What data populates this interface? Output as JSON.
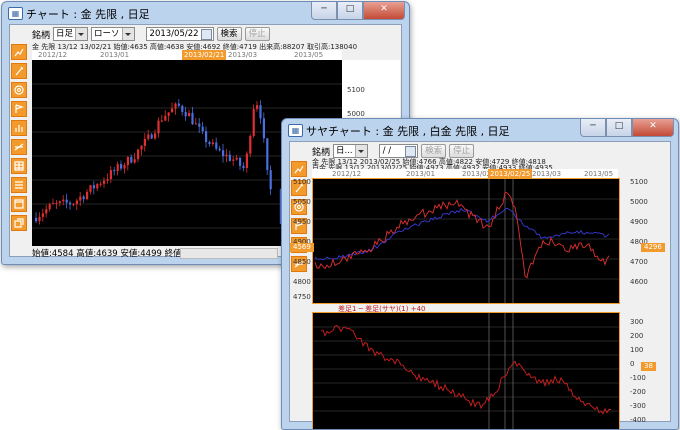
{
  "window1": {
    "title": "チャート : 金 先限 , 日足",
    "controls": {
      "minimize": "─",
      "maximize": "□",
      "close": "✕"
    },
    "toolbar": {
      "symbol_label": "銘柄",
      "period_value": "日足",
      "type_value": "ローソ",
      "date_value": "2013/05/22",
      "search_label": "検索",
      "stop_label": "停止"
    },
    "info_line": "金 先限  13/12  13/02/21  始値:4635 高値:4638 安値:4692 終値:4719 出来高:88207 取引高:138040",
    "date_labels": [
      "2012/12",
      "2013/01",
      "2013/02/21",
      "2013/03",
      "2013/05"
    ],
    "y_labels": [
      "5100",
      "5000",
      "4900",
      "4800",
      "4700",
      "4600",
      "4500"
    ],
    "status": {
      "open": "始値:4584",
      "high": "高値:4639",
      "low": "安値:4499",
      "close": "終値:4500"
    }
  },
  "window2": {
    "title": "サヤチャート : 金 先限 , 白金 先限 , 日足",
    "controls": {
      "minimize": "─",
      "maximize": "□",
      "close": "✕"
    },
    "toolbar": {
      "symbol_label": "銘柄",
      "period_value": "日...",
      "date_value": "/  /",
      "search_label": "検索",
      "stop_label": "停止"
    },
    "info_lines": [
      "金 先限  13/12  2013/02/25  始値:4766 高値:4822 安値:4729 終値:4818",
      "白金 先限  13/12  2013/02/25  始値:4973 高値:4932 安値:4933 終値:4935"
    ],
    "date_labels": [
      "2012/12",
      "2013/01",
      "2013/02",
      "2013/02/25",
      "2013/03",
      "2013/05"
    ],
    "left_y_labels": [
      "5100",
      "5050",
      "4950",
      "4900",
      "4850",
      "4800",
      "4750"
    ],
    "right_y_labels": [
      "5100",
      "5000",
      "4900",
      "4800",
      "4700",
      "4600"
    ],
    "left_tag": "4569",
    "right_tag": "4296",
    "spread_label": "差足1 ─ 差足(サヤ)(1) +40",
    "lower_y_labels": [
      "300",
      "200",
      "100",
      "0",
      "-100",
      "-200",
      "-300",
      "-400"
    ],
    "lower_tag": "38",
    "series": {
      "gold_color": "#e03030",
      "platinum_color": "#3a3ad8",
      "spread_color": "#d02020"
    }
  },
  "sidebar_icons": [
    "chart-icon",
    "pencil-icon",
    "gear-icon",
    "flag-icon",
    "bars-icon",
    "line-icon",
    "table-icon",
    "list-icon",
    "window-icon",
    "copy-icon"
  ]
}
